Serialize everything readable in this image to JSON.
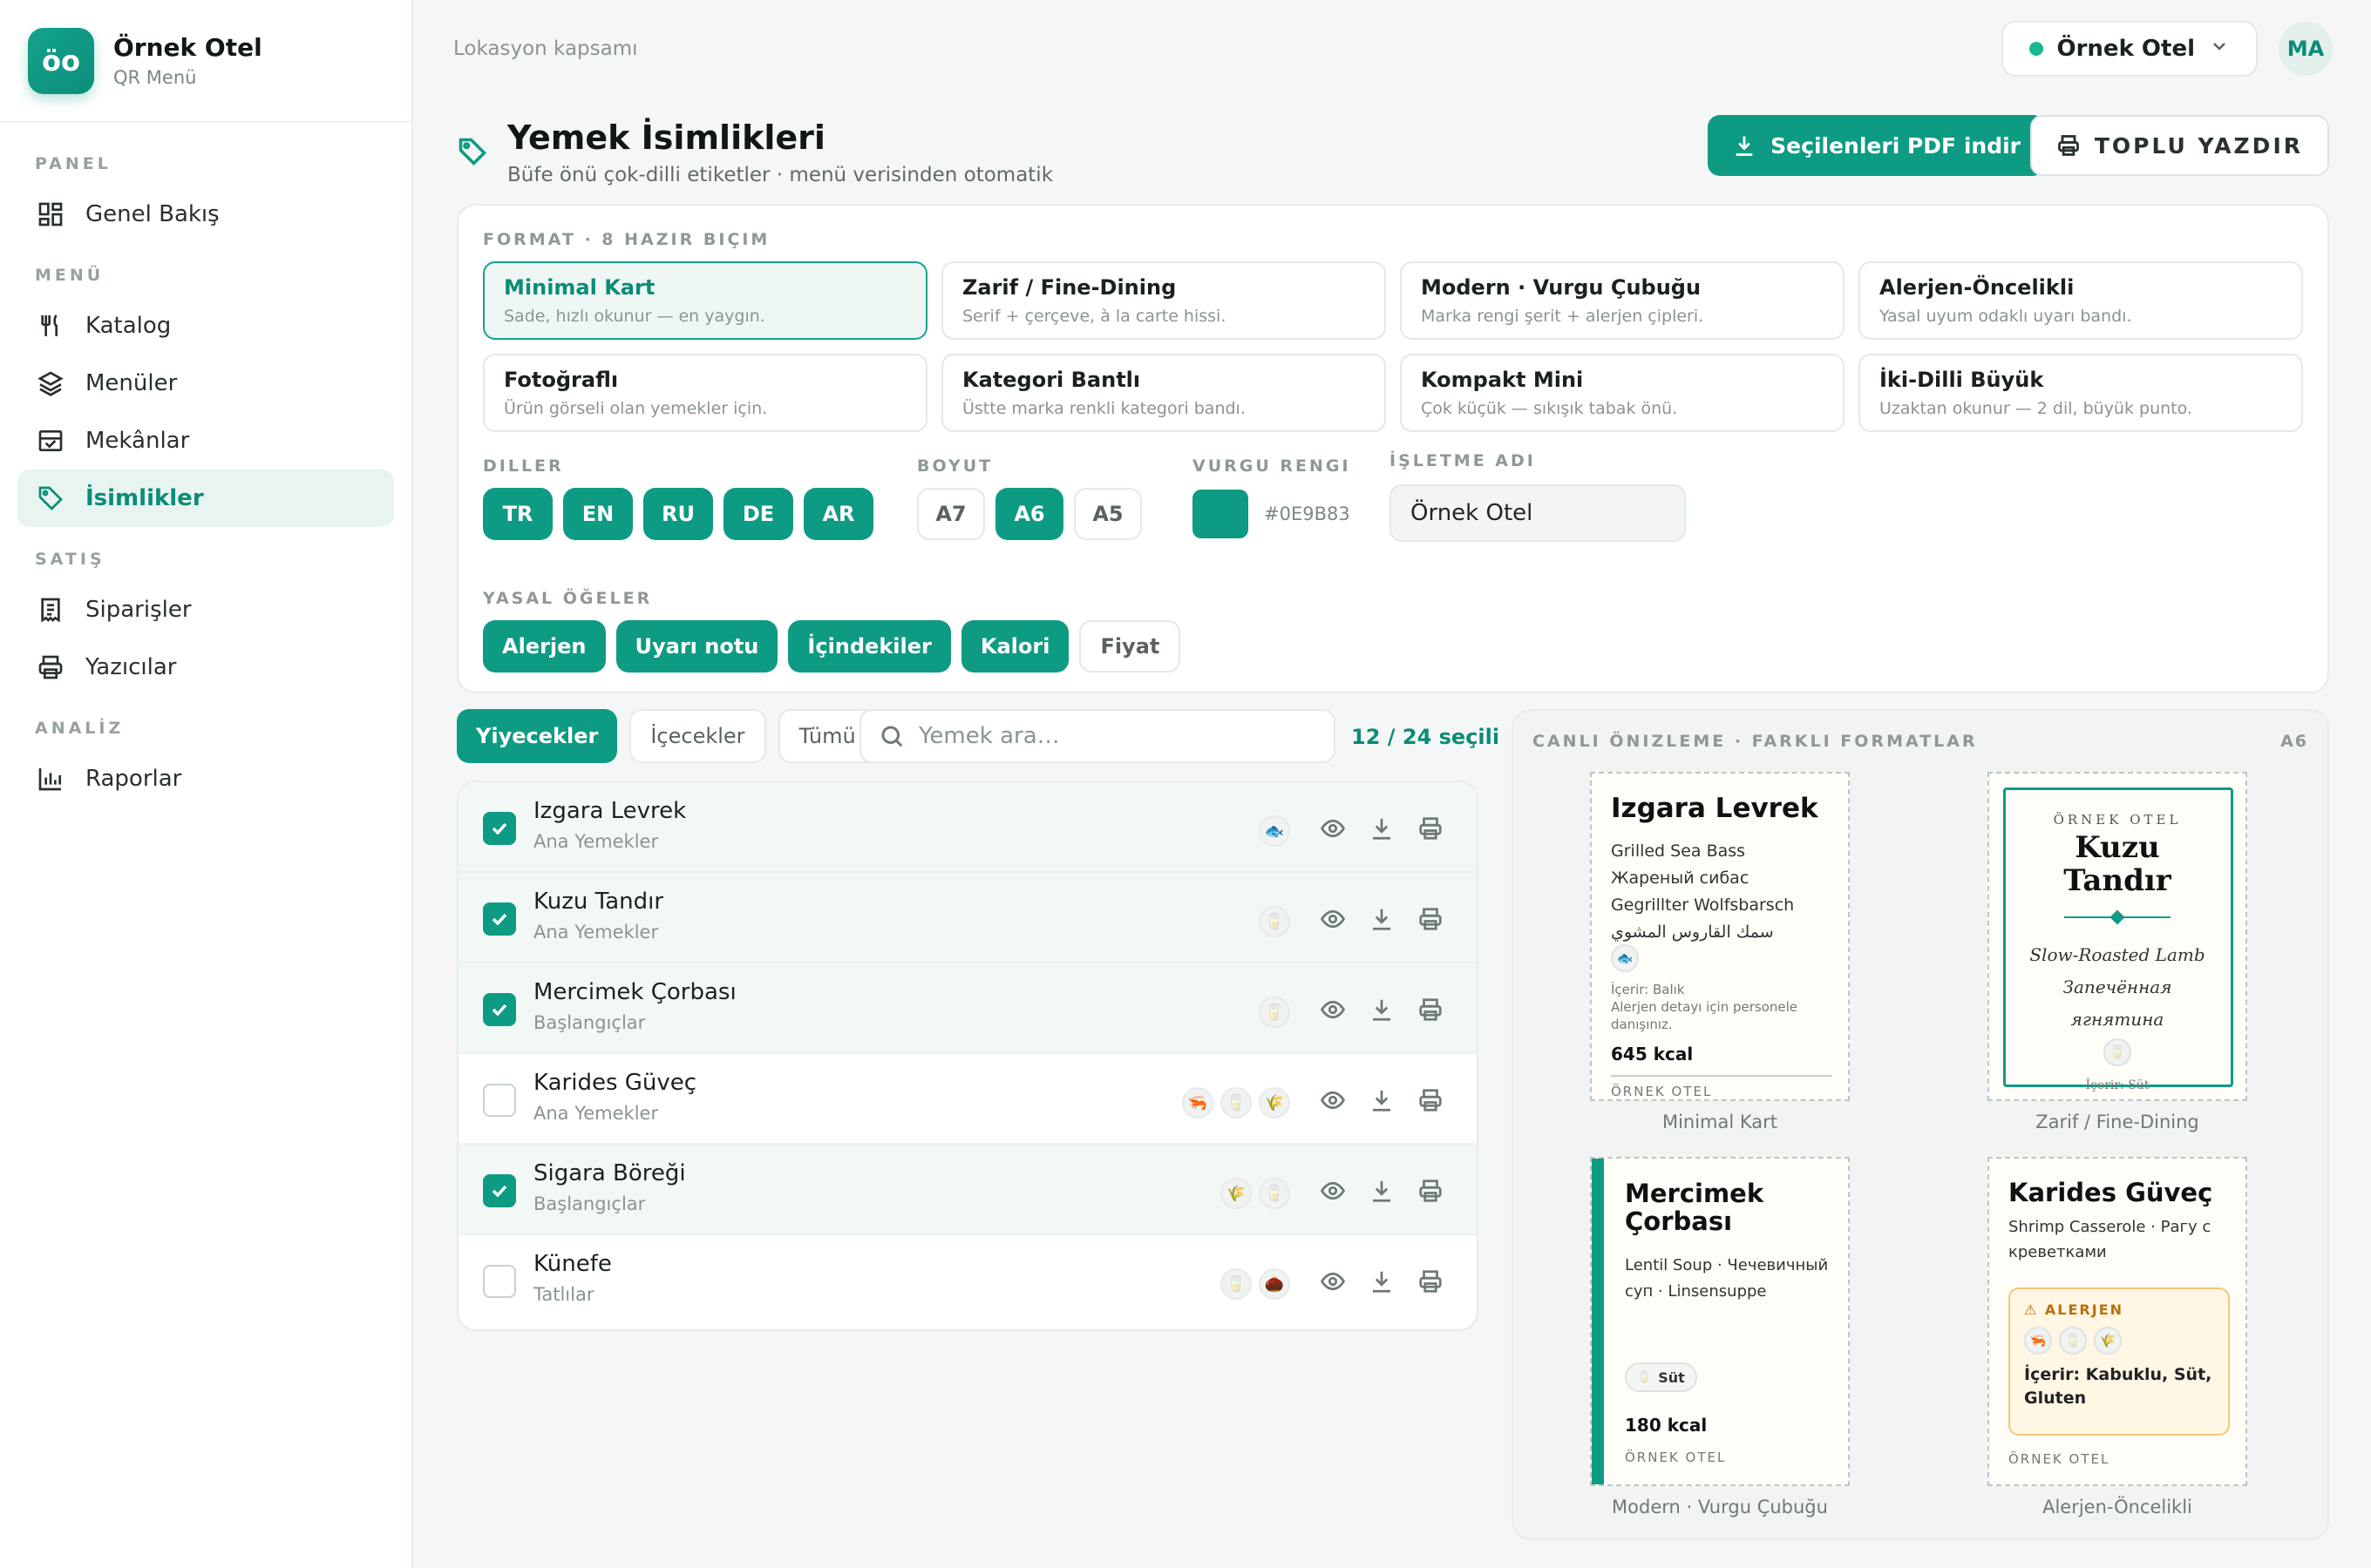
{
  "brand": {
    "logo": "öo",
    "name": "Örnek Otel",
    "sub": "QR Menü"
  },
  "nav": {
    "sec_panel": "PANEL",
    "overview": "Genel Bakış",
    "sec_menu": "MENÜ",
    "catalog": "Katalog",
    "menus": "Menüler",
    "venues": "Mekânlar",
    "labels": "İsimlikler",
    "sec_sales": "SATIŞ",
    "orders": "Siparişler",
    "printers": "Yazıcılar",
    "sec_analysis": "ANALİZ",
    "reports": "Raporlar"
  },
  "topbar": {
    "breadcrumb": "Lokasyon kapsamı",
    "location": "Örnek Otel",
    "avatar": "MA"
  },
  "page": {
    "title": "Yemek İsimlikleri",
    "subtitle": "Büfe önü çok-dilli etiketler · menü verisinden otomatik",
    "pdf_button": "Seçilenleri PDF indir",
    "print_button": "TOPLU YAZDIR"
  },
  "config": {
    "format_label": "FORMAT · 8 HAZIR BIÇIM",
    "formats": [
      {
        "title": "Minimal Kart",
        "desc": "Sade, hızlı okunur — en yaygın."
      },
      {
        "title": "Zarif / Fine-Dining",
        "desc": "Serif + çerçeve, à la carte hissi."
      },
      {
        "title": "Modern · Vurgu Çubuğu",
        "desc": "Marka rengi şerit + alerjen çipleri."
      },
      {
        "title": "Alerjen-Öncelikli",
        "desc": "Yasal uyum odaklı uyarı bandı."
      },
      {
        "title": "Fotoğraflı",
        "desc": "Ürün görseli olan yemekler için."
      },
      {
        "title": "Kategori Bantlı",
        "desc": "Üstte marka renkli kategori bandı."
      },
      {
        "title": "Kompakt Mini",
        "desc": "Çok küçük — sıkışık tabak önü."
      },
      {
        "title": "İki-Dilli Büyük",
        "desc": "Uzaktan okunur — 2 dil, büyük punto."
      }
    ],
    "selected_format": "Minimal Kart",
    "languages_label": "DILLER",
    "languages": [
      "TR",
      "EN",
      "RU",
      "DE",
      "AR"
    ],
    "size_label": "BOYUT",
    "sizes": [
      "A7",
      "A6",
      "A5"
    ],
    "selected_size": "A6",
    "accent_label": "VURGU RENGI",
    "accent_hex": "#0E9B83",
    "business_label": "İŞLETME ADI",
    "business_name": "Örnek Otel",
    "legal_label": "YASAL ÖĞELER",
    "legal": [
      {
        "label": "Alerjen",
        "on": true
      },
      {
        "label": "Uyarı notu",
        "on": true
      },
      {
        "label": "İçindekiler",
        "on": true
      },
      {
        "label": "Kalori",
        "on": true
      },
      {
        "label": "Fiyat",
        "on": false
      }
    ]
  },
  "filter": {
    "tabs": [
      "Yiyecekler",
      "İçecekler",
      "Tümü"
    ],
    "active_tab": "Yiyecekler",
    "search_placeholder": "Yemek ara…",
    "selected_count": "12 / 24 seçili"
  },
  "items": [
    {
      "name": "Izgara Levrek",
      "category": "Ana Yemekler",
      "checked": true,
      "allergens": [
        "fish-icon"
      ]
    },
    {
      "name": "Kuzu Tandır",
      "category": "Ana Yemekler",
      "checked": true,
      "allergens": [
        "milk-icon"
      ]
    },
    {
      "name": "Mercimek Çorbası",
      "category": "Başlangıçlar",
      "checked": true,
      "allergens": [
        "milk-icon"
      ]
    },
    {
      "name": "Karides Güveç",
      "category": "Ana Yemekler",
      "checked": false,
      "allergens": [
        "shrimp-icon",
        "milk-icon",
        "wheat-icon"
      ]
    },
    {
      "name": "Sigara Böreği",
      "category": "Başlangıçlar",
      "checked": true,
      "allergens": [
        "wheat-icon",
        "milk-icon"
      ]
    },
    {
      "name": "Künefe",
      "category": "Tatlılar",
      "checked": false,
      "allergens": [
        "milk-icon",
        "nut-icon"
      ]
    }
  ],
  "preview": {
    "label": "CANLI ÖNIZLEME · FARKLI FORMATLAR",
    "size": "A6",
    "card1": {
      "title": "Izgara Levrek",
      "lines": [
        "Grilled Sea Bass",
        "Жареный сибас",
        "Gegrillter Wolfsbarsch",
        "سمك القاروس المشوي"
      ],
      "contains": "İçerir: Balık",
      "note": "Alerjen detayı için personele danışınız.",
      "kcal": "645 kcal",
      "footer": "ÖRNEK OTEL",
      "caption": "Minimal Kart"
    },
    "card2": {
      "brand": "ÖRNEK OTEL",
      "title": "Kuzu Tandır",
      "lines": [
        "Slow-Roasted Lamb",
        "Запечённая",
        "ягнятина"
      ],
      "contains": "İçerir: Süt",
      "caption": "Zarif / Fine-Dining"
    },
    "card3": {
      "title": "Mercimek Çorbası",
      "lines": "Lentil Soup · Чечевичный суп · Linsensuppe",
      "chip": "Süt",
      "kcal": "180 kcal",
      "footer": "ÖRNEK OTEL",
      "caption": "Modern · Vurgu Çubuğu"
    },
    "card4": {
      "title": "Karides Güveç",
      "lines": "Shrimp Casserole · Рагу с креветками",
      "warn": "⚠ ALERJEN",
      "contains": "İçerir: Kabuklu, Süt, Gluten",
      "footer": "ÖRNEK OTEL",
      "caption": "Alerjen-Öncelikli"
    }
  }
}
